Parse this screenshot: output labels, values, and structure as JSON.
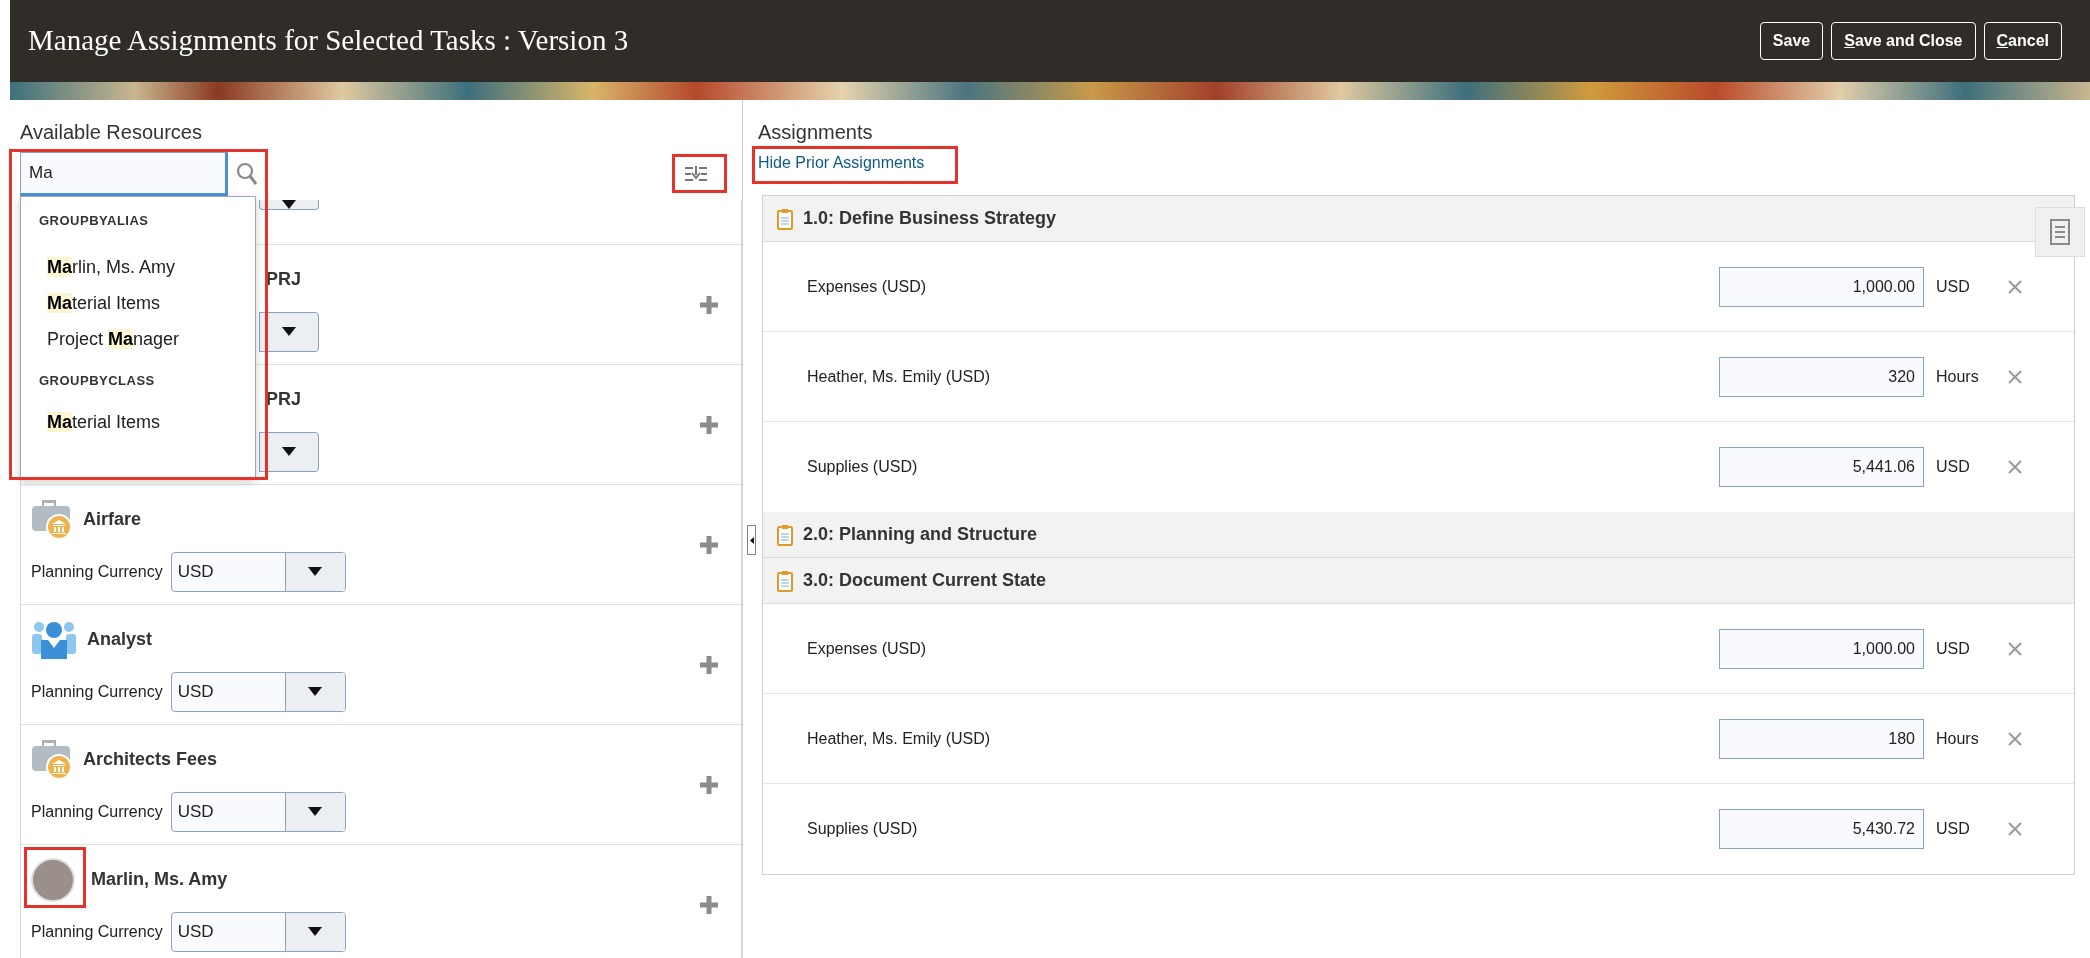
{
  "header": {
    "title": "Manage Assignments for Selected Tasks : Version 3",
    "buttons": [
      {
        "label": "Save"
      },
      {
        "mnemonic": "S",
        "label_rest": "ave and Close"
      },
      {
        "mnemonic": "C",
        "label_rest": "ancel"
      }
    ]
  },
  "left": {
    "title": "Available Resources",
    "search": {
      "value": "Ma",
      "highlighted": true
    },
    "filter_button": {
      "highlighted": true
    },
    "suggestions": [
      {
        "heading": "GROUPBYALIAS",
        "items": [
          {
            "match": "Ma",
            "after": "rlin, Ms. Amy"
          },
          {
            "match": "Ma",
            "after": "terial Items"
          },
          {
            "before": "Project ",
            "match": "Ma",
            "after": "nager"
          }
        ]
      },
      {
        "heading": "GROUPBYCLASS",
        "items": [
          {
            "match": "Ma",
            "after": "terial Items"
          }
        ]
      }
    ],
    "resources": [
      {
        "kind": "clipped"
      },
      {
        "kind": "covered",
        "name": "PRJ"
      },
      {
        "kind": "covered",
        "name": "PRJ"
      },
      {
        "kind": "expense",
        "name": "Airfare",
        "currency_label": "Planning Currency",
        "currency": "USD"
      },
      {
        "kind": "role",
        "name": "Analyst",
        "currency_label": "Planning Currency",
        "currency": "USD"
      },
      {
        "kind": "expense",
        "name": "Architects Fees",
        "currency_label": "Planning Currency",
        "currency": "USD"
      },
      {
        "kind": "person",
        "name": "Marlin, Ms. Amy",
        "highlighted": true,
        "currency_label": "Planning Currency",
        "currency": "USD"
      }
    ]
  },
  "right": {
    "title": "Assignments",
    "link": {
      "label": "Hide Prior Assignments",
      "highlighted": true
    },
    "tasks": [
      {
        "title": "1.0: Define Business Strategy",
        "assignments": [
          {
            "name": "Expenses (USD)",
            "amount": "1,000.00",
            "unit": "USD"
          },
          {
            "name": "Heather, Ms. Emily (USD)",
            "amount": "320",
            "unit": "Hours"
          },
          {
            "name": "Supplies (USD)",
            "amount": "5,441.06",
            "unit": "USD"
          }
        ]
      },
      {
        "title": "2.0: Planning and Structure"
      },
      {
        "title": "3.0: Document Current State",
        "assignments": [
          {
            "name": "Expenses (USD)",
            "amount": "1,000.00",
            "unit": "USD"
          },
          {
            "name": "Heather, Ms. Emily (USD)",
            "amount": "180",
            "unit": "Hours"
          },
          {
            "name": "Supplies (USD)",
            "amount": "5,430.72",
            "unit": "USD"
          }
        ]
      }
    ]
  }
}
